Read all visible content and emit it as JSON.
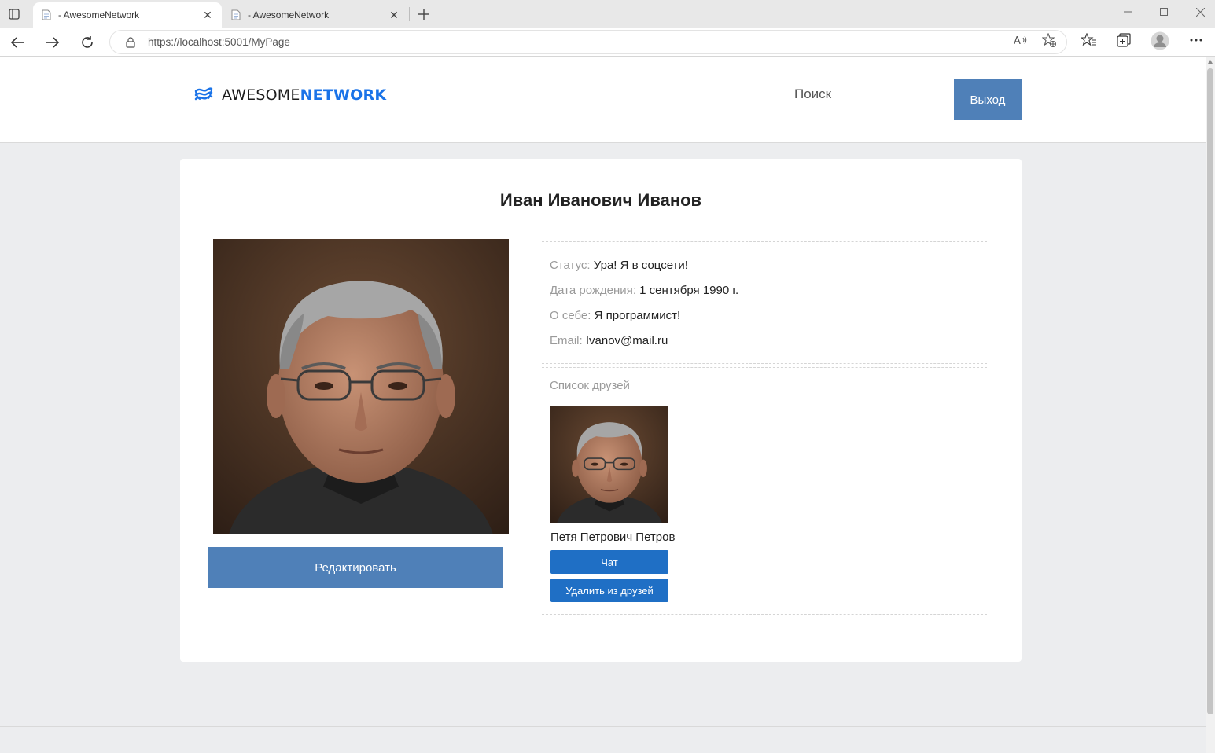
{
  "browser": {
    "tabs": [
      {
        "title": "- AwesomeNetwork",
        "active": true
      },
      {
        "title": "- AwesomeNetwork",
        "active": false
      }
    ],
    "url": "https://localhost:5001/MyPage",
    "close_glyph": "✕",
    "icons": [
      "tab-actions-icon",
      "page-favicon-icon",
      "new-tab-icon",
      "minimize-icon",
      "maximize-icon",
      "window-close-icon",
      "back-icon",
      "forward-icon",
      "refresh-icon",
      "lock-icon",
      "read-aloud-icon",
      "add-favorite-icon",
      "favorites-icon",
      "collections-icon",
      "profile-icon",
      "more-icon"
    ]
  },
  "header": {
    "logo_part1": "AWESOME",
    "logo_part2": "NETWORK",
    "nav_search": "Поиск",
    "logout_label": "Выход"
  },
  "profile": {
    "full_name": "Иван Иванович Иванов",
    "edit_label": "Редактировать",
    "status_label": "Статус:",
    "status_value": "Ура! Я в соцсети!",
    "birth_label": "Дата рождения:",
    "birth_value": "1 сентября 1990 г.",
    "about_label": "О себе:",
    "about_value": "Я программист!",
    "email_label": "Email:",
    "email_value": "Ivanov@mail.ru"
  },
  "friends": {
    "title": "Список друзей",
    "items": [
      {
        "name": "Петя Петрович Петров",
        "chat_label": "Чат",
        "remove_label": "Удалить из друзей"
      }
    ]
  },
  "colors": {
    "accent_button": "#4f80b8",
    "friend_button": "#1f6fc5",
    "logo_blue": "#1a73e8",
    "page_bg": "#ecedef"
  }
}
